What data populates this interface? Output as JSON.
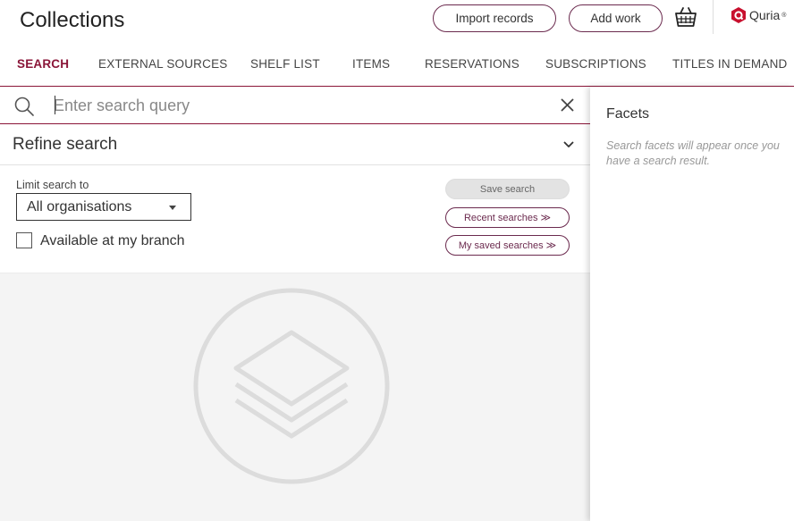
{
  "header": {
    "title": "Collections",
    "import_records_label": "Import records",
    "add_work_label": "Add work",
    "basket_icon": "basket-icon",
    "brand_name": "Quria",
    "brand_mark": "®",
    "accent_color": "#8a1538"
  },
  "nav": {
    "tabs": [
      {
        "label": "SEARCH",
        "active": true
      },
      {
        "label": "EXTERNAL SOURCES",
        "active": false
      },
      {
        "label": "SHELF LIST",
        "active": false
      },
      {
        "label": "ITEMS",
        "active": false
      },
      {
        "label": "RESERVATIONS",
        "active": false
      },
      {
        "label": "SUBSCRIPTIONS",
        "active": false
      },
      {
        "label": "TITLES IN DEMAND",
        "active": false
      }
    ]
  },
  "search": {
    "placeholder": "Enter search query",
    "value": ""
  },
  "refine": {
    "label": "Refine search",
    "limit_label": "Limit search to",
    "organisation_selected": "All organisations",
    "available_at_branch_label": "Available at my branch",
    "available_at_branch_checked": false,
    "save_search_label": "Save search",
    "recent_searches_label": "Recent searches ≫",
    "saved_searches_label": "My saved searches ≫"
  },
  "facets": {
    "title": "Facets",
    "hint": "Search facets will appear once you have a search result."
  }
}
